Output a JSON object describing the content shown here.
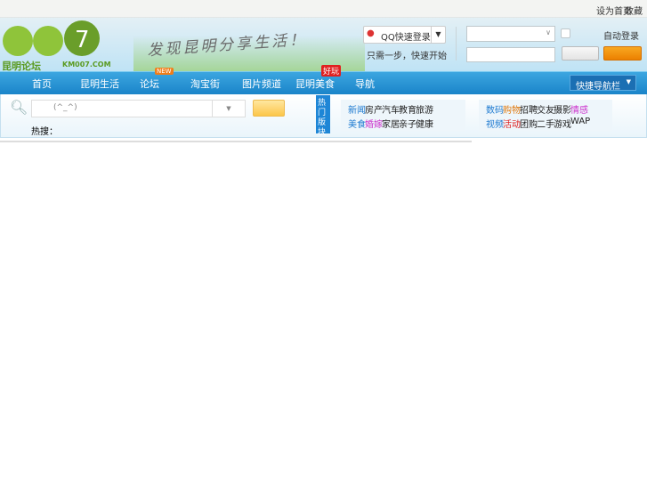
{
  "top_links": [
    "设为首页",
    "收藏"
  ],
  "logo": {
    "text": "昆明论坛",
    "sub": "KM007.COM"
  },
  "slogan": "发现昆明分享生活！",
  "qq": {
    "label": "QQ快速登录",
    "tip": "只需一步，快速开始"
  },
  "login": {
    "remember": "自动登录"
  },
  "nav": [
    {
      "label": "首页"
    },
    {
      "label": "昆明生活"
    },
    {
      "label": "论坛",
      "badge": "NEW"
    },
    {
      "label": "淘宝街"
    },
    {
      "label": "图片频道"
    },
    {
      "label": "昆明美食",
      "badge": "好玩"
    },
    {
      "label": "导航"
    }
  ],
  "nav_dropdown": "快捷导航栏",
  "search": {
    "placeholder": "(^_^)",
    "hot_label": "热搜："
  },
  "hot_tab": "热门版块",
  "links_a": [
    [
      "新闻",
      "房产",
      "汽车",
      "教育",
      "旅游"
    ],
    [
      "美食",
      "婚嫁",
      "家居",
      "亲子",
      "健康"
    ]
  ],
  "links_b": [
    [
      "数码",
      "购物",
      "招聘",
      "交友",
      "摄影",
      "情感"
    ],
    [
      "视频",
      "活动",
      "团购",
      "二手",
      "游戏",
      "WAP"
    ]
  ],
  "colors": {
    "nav": "#1a84c9",
    "accent": "#f08a00"
  }
}
